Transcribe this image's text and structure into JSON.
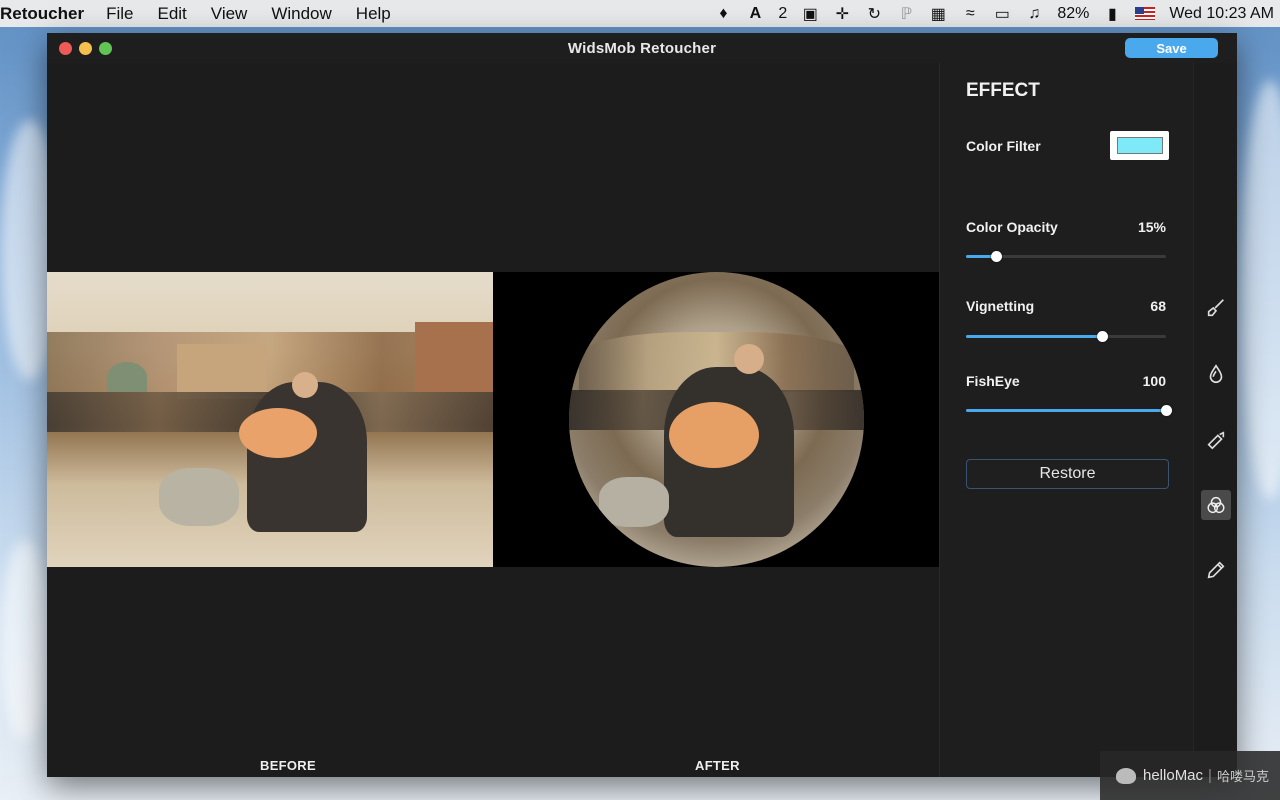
{
  "menubar": {
    "app_name": "Retoucher",
    "menus": [
      "File",
      "Edit",
      "View",
      "Window",
      "Help"
    ],
    "adobe_count": "2",
    "battery": "82%",
    "clock": "Wed 10:23 AM"
  },
  "window": {
    "title": "WidsMob Retoucher",
    "save_label": "Save"
  },
  "canvas": {
    "before_label": "BEFORE",
    "after_label": "AFTER"
  },
  "panel": {
    "title": "EFFECT",
    "color_filter_label": "Color Filter",
    "color_filter_value": "#7ee9f7",
    "opacity": {
      "label": "Color Opacity",
      "value": "15%",
      "level": 0.15
    },
    "vignetting": {
      "label": "Vignetting",
      "value": "68",
      "level": 0.68
    },
    "fisheye": {
      "label": "FishEye",
      "value": "100",
      "level": 1.0
    },
    "restore_label": "Restore"
  },
  "tools": [
    "brush-icon",
    "drop-icon",
    "bandage-icon",
    "color-filter-icon",
    "pencil-icon"
  ],
  "accent_color": "#4aa8ec",
  "watermark": {
    "brand": "helloMac",
    "cn": "哈喽马克"
  }
}
